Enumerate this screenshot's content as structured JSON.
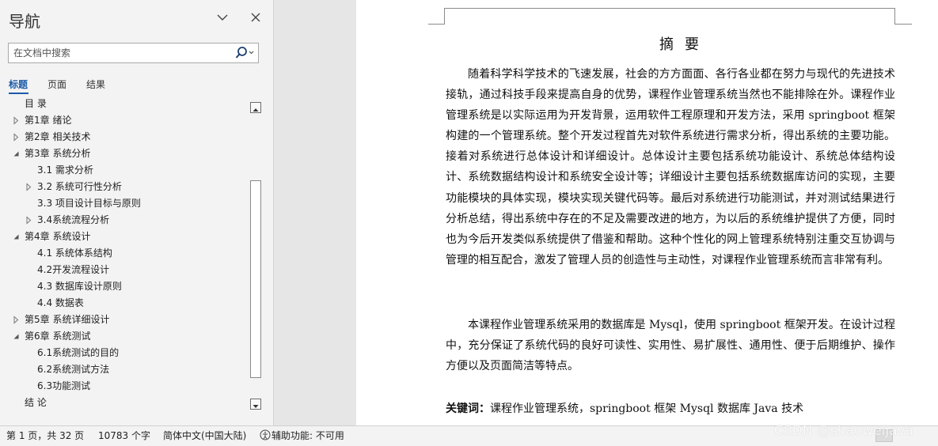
{
  "nav": {
    "title": "导航",
    "search_placeholder": "在文档中搜索",
    "tabs": [
      "标题",
      "页面",
      "结果"
    ],
    "tree": [
      {
        "label": "目 录",
        "indent": 0,
        "twisty": "none"
      },
      {
        "label": "第1章 绪论",
        "indent": 0,
        "twisty": "collapsed"
      },
      {
        "label": "第2章 相关技术",
        "indent": 0,
        "twisty": "collapsed"
      },
      {
        "label": "第3章 系统分析",
        "indent": 0,
        "twisty": "expanded"
      },
      {
        "label": "3.1 需求分析",
        "indent": 1,
        "twisty": "none"
      },
      {
        "label": "3.2 系统可行性分析",
        "indent": 1,
        "twisty": "collapsed"
      },
      {
        "label": "3.3 项目设计目标与原则",
        "indent": 1,
        "twisty": "none"
      },
      {
        "label": "3.4系统流程分析",
        "indent": 1,
        "twisty": "collapsed"
      },
      {
        "label": "第4章 系统设计",
        "indent": 0,
        "twisty": "expanded"
      },
      {
        "label": "4.1 系统体系结构",
        "indent": 1,
        "twisty": "none"
      },
      {
        "label": "4.2开发流程设计",
        "indent": 1,
        "twisty": "none"
      },
      {
        "label": "4.3 数据库设计原则",
        "indent": 1,
        "twisty": "none"
      },
      {
        "label": "4.4 数据表",
        "indent": 1,
        "twisty": "none"
      },
      {
        "label": "第5章 系统详细设计",
        "indent": 0,
        "twisty": "collapsed"
      },
      {
        "label": "第6章  系统测试",
        "indent": 0,
        "twisty": "expanded"
      },
      {
        "label": "6.1系统测试的目的",
        "indent": 1,
        "twisty": "none"
      },
      {
        "label": "6.2系统测试方法",
        "indent": 1,
        "twisty": "none"
      },
      {
        "label": "6.3功能测试",
        "indent": 1,
        "twisty": "none"
      },
      {
        "label": "结  论",
        "indent": 0,
        "twisty": "none"
      }
    ]
  },
  "document": {
    "title": "摘要",
    "paragraphs": [
      "随着科学科学技术的飞速发展，社会的方方面面、各行各业都在努力与现代的先进技术接轨，通过科技手段来提高自身的优势，课程作业管理系统当然也不能排除在外。课程作业管理系统是以实际运用为开发背景，运用软件工程原理和开发方法，采用 springboot 框架构建的一个管理系统。整个开发过程首先对软件系统进行需求分析，得出系统的主要功能。接着对系统进行总体设计和详细设计。总体设计主要包括系统功能设计、系统总体结构设计、系统数据结构设计和系统安全设计等；详细设计主要包括系统数据库访问的实现，主要功能模块的具体实现，模块实现关键代码等。最后对系统进行功能测试，并对测试结果进行分析总结，得出系统中存在的不足及需要改进的地方，为以后的系统维护提供了方便，同时也为今后开发类似系统提供了借鉴和帮助。这种个性化的网上管理系统特别注重交互协调与管理的相互配合，激发了管理人员的创造性与主动性，对课程作业管理系统而言非常有利。",
      "本课程作业管理系统采用的数据库是 Mysql，使用 springboot 框架开发。在设计过程中，充分保证了系统代码的良好可读性、实用性、易扩展性、通用性、便于后期维护、操作方便以及页面简洁等特点。"
    ],
    "keywords_label": "关键词：",
    "keywords_text": "课程作业管理系统，springboot 框架 Mysql 数据库 Java 技术"
  },
  "status": {
    "page": "第 1 页，共 32 页",
    "words": "10783 个字",
    "language": "简体中文(中国大陆)",
    "accessibility": "辅助功能: 不可用"
  },
  "watermark": "CSDN @shaoweijava",
  "colors": {
    "accent": "#1d5aa8",
    "nav_bg": "#f3f3f3",
    "doc_bg": "#e6e6e6"
  }
}
